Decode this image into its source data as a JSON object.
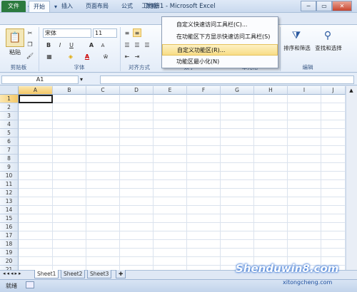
{
  "window": {
    "title": "工作簿1 - Microsoft Excel",
    "controls": [
      "─",
      "▭",
      "✕"
    ]
  },
  "qat": {
    "save_icon": "floppy-icon",
    "undo_icon": "undo-icon",
    "redo_icon": "redo-icon"
  },
  "tabs": [
    {
      "label": "文件"
    },
    {
      "label": "开始"
    },
    {
      "label": "插入"
    },
    {
      "label": "页面布局"
    },
    {
      "label": "公式"
    },
    {
      "label": "数据"
    }
  ],
  "ribbon": {
    "clipboard": {
      "paste": "粘贴",
      "label": "剪贴板"
    },
    "font": {
      "name": "宋体",
      "size": "11",
      "label": "字体",
      "bold": "B",
      "italic": "I",
      "underline": "U",
      "grow": "A",
      "shrink": "A"
    },
    "align": {
      "label": "对齐方式"
    },
    "number": {
      "label": "数字"
    },
    "cells": {
      "label": "单元格"
    },
    "editing": {
      "sort": "排序和筛选",
      "find": "查找和选择",
      "label": "编辑"
    }
  },
  "formula_bar": {
    "namebox": "A1",
    "fx": "fx",
    "value": ""
  },
  "columns": [
    "A",
    "B",
    "C",
    "D",
    "E",
    "F",
    "G",
    "H",
    "I",
    "J"
  ],
  "rows": [
    "1",
    "2",
    "3",
    "4",
    "5",
    "6",
    "7",
    "8",
    "9",
    "10",
    "11",
    "12",
    "13",
    "14",
    "15",
    "16",
    "17",
    "18",
    "19",
    "20",
    "21"
  ],
  "sheets": [
    "Sheet1",
    "Sheet2",
    "Sheet3"
  ],
  "status": {
    "ready": "就绪"
  },
  "context_menu": {
    "items": [
      "自定义快速访问工具栏(C)...",
      "在功能区下方显示快速访问工具栏(S)",
      "自定义功能区(R)...",
      "功能区最小化(N)"
    ]
  },
  "watermark": {
    "line1": "Shenduwin8.com",
    "line2": "xitongcheng.com"
  }
}
